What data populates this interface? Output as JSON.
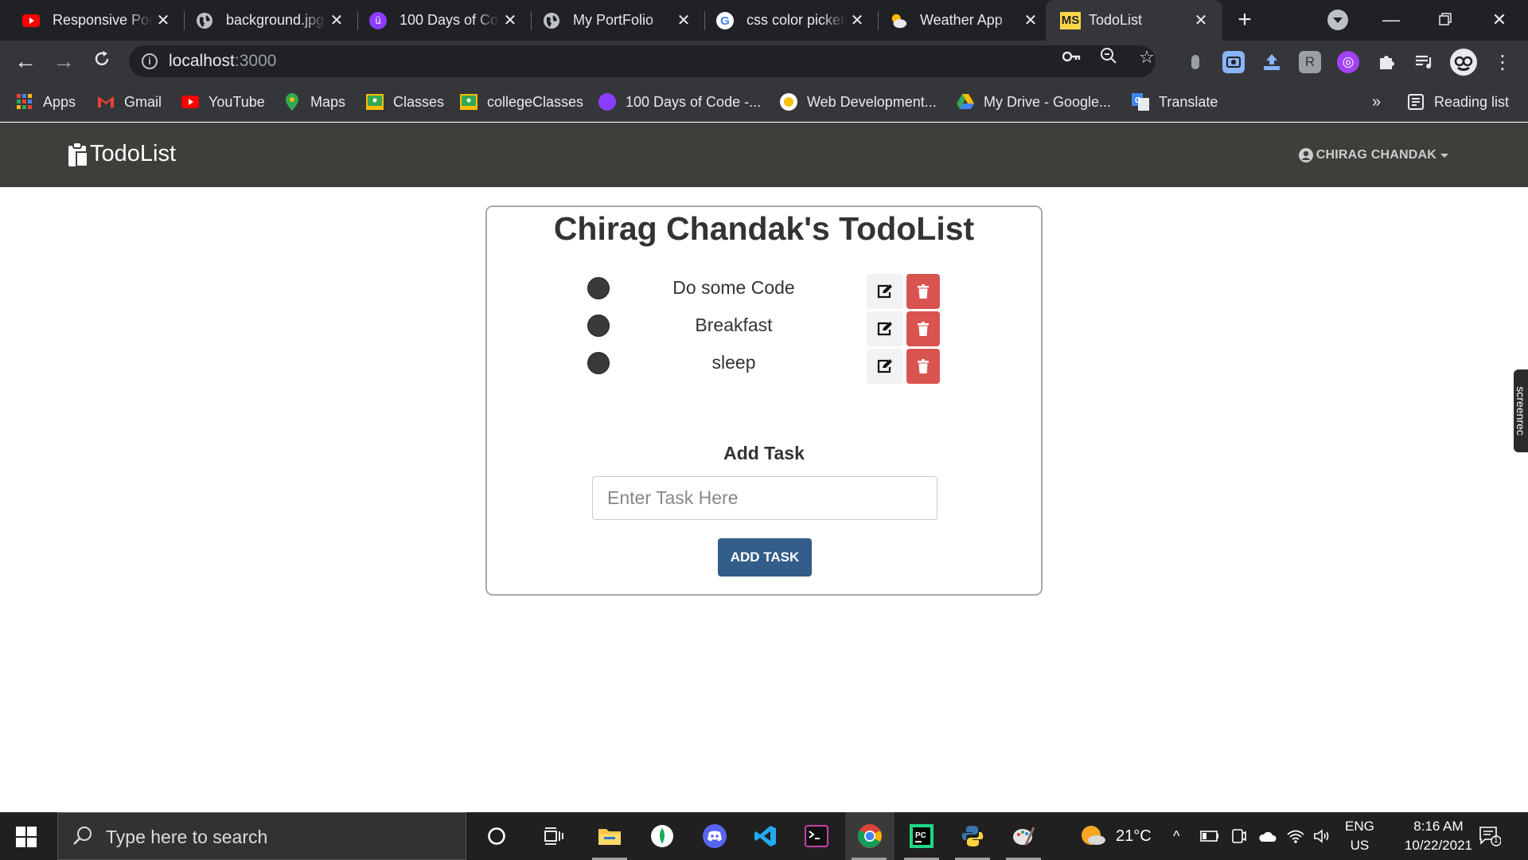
{
  "browser": {
    "tabs": [
      {
        "title": "Responsive Por",
        "icon": "youtube-icon"
      },
      {
        "title": "background.jpg",
        "icon": "globe-icon"
      },
      {
        "title": "100 Days of Co",
        "icon": "100-days-icon"
      },
      {
        "title": "My PortFolio",
        "icon": "globe-icon"
      },
      {
        "title": "css color picker",
        "icon": "google-icon"
      },
      {
        "title": "Weather App",
        "icon": "weather-icon"
      },
      {
        "title": "TodoList",
        "icon": "ms-icon"
      }
    ],
    "favicon_ms_text": "MS",
    "address": {
      "host": "localhost",
      "port": ":3000"
    },
    "bookmarks": [
      {
        "label": "Apps",
        "icon": "apps-icon"
      },
      {
        "label": "Gmail",
        "icon": "gmail-icon"
      },
      {
        "label": "YouTube",
        "icon": "youtube-icon"
      },
      {
        "label": "Maps",
        "icon": "maps-icon"
      },
      {
        "label": "Classes",
        "icon": "classroom-icon"
      },
      {
        "label": "collegeClasses",
        "icon": "classroom-icon"
      },
      {
        "label": "100 Days of Code -...",
        "icon": "100-days-icon"
      },
      {
        "label": "Web Development...",
        "icon": "udemy-icon"
      },
      {
        "label": "My Drive - Google...",
        "icon": "drive-icon"
      },
      {
        "label": "Translate",
        "icon": "translate-icon"
      }
    ],
    "bookmarks_overflow": "»",
    "reading_list": "Reading list"
  },
  "app": {
    "brand": "TodoList",
    "user": "CHIRAG CHANDAK"
  },
  "todo": {
    "title": "Chirag Chandak's TodoList",
    "items": [
      {
        "text": "Do some Code"
      },
      {
        "text": "Breakfast"
      },
      {
        "text": "sleep"
      }
    ],
    "add_label": "Add Task",
    "input_placeholder": "Enter Task Here",
    "add_button": "ADD TASK"
  },
  "screenrec": "screenrec",
  "taskbar": {
    "search_placeholder": "Type here to search",
    "weather": "21°C",
    "lang_top": "ENG",
    "lang_bottom": "US",
    "time": "8:16 AM",
    "date": "10/22/2021",
    "notifications": "1"
  },
  "colors": {
    "navbar": "#3e3f3a",
    "delete": "#d9534f",
    "add_button": "#325d88"
  }
}
